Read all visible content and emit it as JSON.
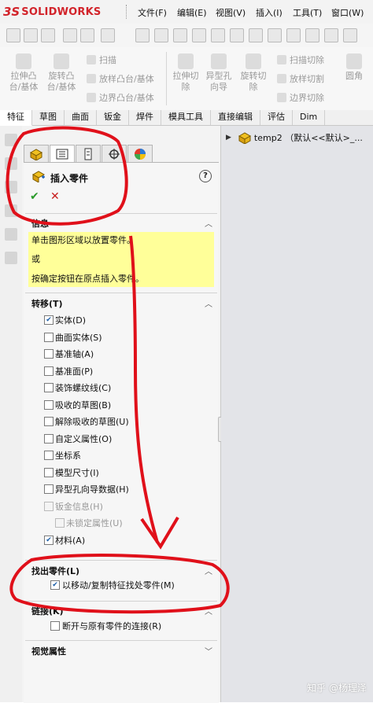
{
  "app": {
    "logo_ds": "3S",
    "logo_text": "SOLIDWORKS"
  },
  "menu": [
    "文件(F)",
    "编辑(E)",
    "视图(V)",
    "插入(I)",
    "工具(T)",
    "窗口(W)"
  ],
  "command_manager": {
    "big_buttons": [
      {
        "label": "拉伸凸\n台/基体",
        "icon": "extrude-boss-icon"
      },
      {
        "label": "旋转凸\n台/基体",
        "icon": "revolve-boss-icon"
      },
      {
        "label": "拉伸切\n除",
        "icon": "extrude-cut-icon"
      },
      {
        "label": "异型孔\n向导",
        "icon": "hole-wizard-icon"
      },
      {
        "label": "旋转切\n除",
        "icon": "revolve-cut-icon"
      },
      {
        "label": "圆角",
        "icon": "fillet-icon"
      }
    ],
    "small_left": [
      "扫描",
      "放样凸台/基体",
      "边界凸台/基体"
    ],
    "small_right": [
      "扫描切除",
      "放样切割",
      "边界切除"
    ]
  },
  "tabs": [
    "特征",
    "草图",
    "曲面",
    "钣金",
    "焊件",
    "模具工具",
    "直接编辑",
    "评估",
    "Dim"
  ],
  "property_manager": {
    "title": "插入零件",
    "help": "?",
    "ok": "✔",
    "cancel": "✕",
    "info": {
      "title": "信息",
      "lines": [
        "单击图形区域以放置零件。",
        "或",
        "按确定按钮在原点插入零件。"
      ]
    },
    "transfer": {
      "title": "转移(T)",
      "items": [
        {
          "label": "实体(D)",
          "checked": true,
          "disabled": false
        },
        {
          "label": "曲面实体(S)",
          "checked": false,
          "disabled": false
        },
        {
          "label": "基准轴(A)",
          "checked": false,
          "disabled": false
        },
        {
          "label": "基准面(P)",
          "checked": false,
          "disabled": false
        },
        {
          "label": "装饰螺纹线(C)",
          "checked": false,
          "disabled": false
        },
        {
          "label": "吸收的草图(B)",
          "checked": false,
          "disabled": false
        },
        {
          "label": "解除吸收的草图(U)",
          "checked": false,
          "disabled": false
        },
        {
          "label": "自定义属性(O)",
          "checked": false,
          "disabled": false
        },
        {
          "label": "坐标系",
          "checked": false,
          "disabled": false
        },
        {
          "label": "模型尺寸(I)",
          "checked": false,
          "disabled": false
        },
        {
          "label": "异型孔向导数据(H)",
          "checked": false,
          "disabled": false
        },
        {
          "label": "钣金信息(H)",
          "checked": false,
          "disabled": true
        },
        {
          "label": "未锁定属性(U)",
          "checked": false,
          "disabled": true
        },
        {
          "label": "材料(A)",
          "checked": true,
          "disabled": false
        }
      ]
    },
    "locate": {
      "title": "找出零件(L)",
      "item": "以移动/复制特征找处零件(M)",
      "checked": true
    },
    "link": {
      "title": "链接(K)",
      "item": "断开与原有零件的连接(R)",
      "checked": false
    },
    "visual": {
      "title": "视觉属性"
    }
  },
  "tree": {
    "root": "temp2 （默认<<默认>_..."
  },
  "watermark": "知乎 @杨理泽",
  "colors": {
    "brand": "#d2232a",
    "info_bg": "#ffff99",
    "annotation": "#e0101a"
  }
}
